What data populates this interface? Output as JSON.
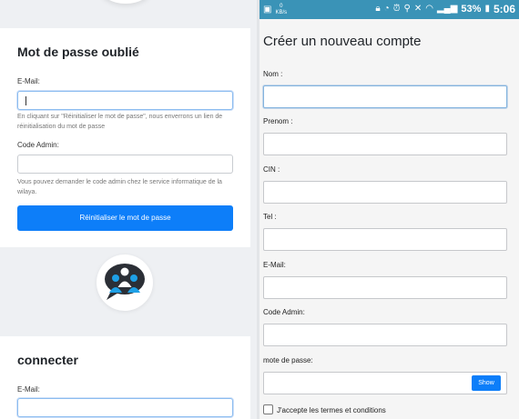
{
  "forgot": {
    "title": "Mot de passe oublié",
    "email_label": "E-Mail:",
    "email_value": "",
    "email_help": "En cliquant sur \"Réinitialiser le mot de passe\", nous enverrons un lien de réinitialisation du mot de passe",
    "code_label": "Code Admin:",
    "code_value": "",
    "code_help": "Vous pouvez demander le code admin chez le service informatique de la wilaya.",
    "reset_button": "Réinitialiser le mot de passe"
  },
  "logo": {
    "icon": "people-chat-icon",
    "colors": [
      "#2b2f36",
      "#1ea0e6",
      "#ffffff"
    ]
  },
  "login": {
    "title": "connecter",
    "email_label": "E-Mail:",
    "email_value": ""
  },
  "status_bar": {
    "data_speed": "0",
    "data_unit": "KB/s",
    "battery": "53%",
    "time": "5:06",
    "color": "#3a93b7"
  },
  "register": {
    "title": "Créer un nouveau compte",
    "fields": [
      {
        "label": "Nom :",
        "value": ""
      },
      {
        "label": "Prenom :",
        "value": ""
      },
      {
        "label": "CIN :",
        "value": ""
      },
      {
        "label": "Tel :",
        "value": ""
      },
      {
        "label": "E-Mail:",
        "value": ""
      },
      {
        "label": "Code Admin:",
        "value": ""
      },
      {
        "label": "mote de passe:",
        "value": ""
      }
    ],
    "show_button": "Show",
    "terms_label": "J'accepte les termes et conditions",
    "terms_checked": false
  },
  "accent_color": "#0d7ef9"
}
